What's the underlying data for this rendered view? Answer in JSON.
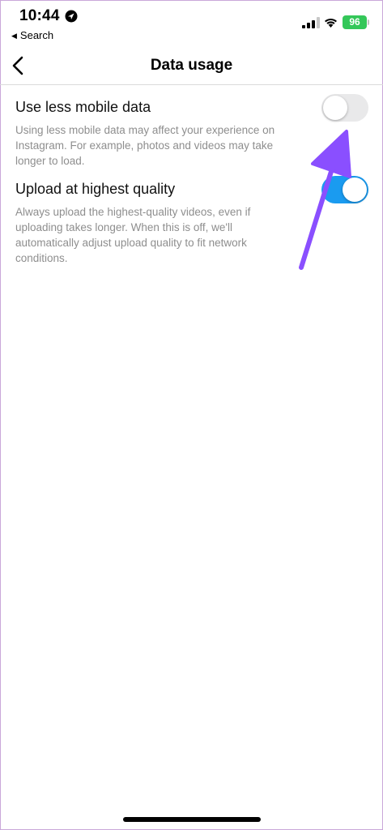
{
  "status_bar": {
    "time": "10:44",
    "back_app": "Search",
    "battery": "96",
    "icons": [
      "location-icon",
      "signal-icon",
      "wifi-icon",
      "battery-icon"
    ]
  },
  "nav": {
    "title": "Data usage",
    "back_icon": "chevron-left-icon"
  },
  "settings": [
    {
      "title": "Use less mobile data",
      "description": "Using less mobile data may affect your experience on Instagram. For example, photos and videos may take longer to load.",
      "enabled": false
    },
    {
      "title": "Upload at highest quality",
      "description": "Always upload the highest-quality videos, even if uploading takes longer. When this is off, we'll automatically adjust upload quality to fit network conditions.",
      "enabled": true
    }
  ],
  "colors": {
    "toggle_on": "#1a9bf0",
    "toggle_off": "#e9e9ea",
    "annotation_arrow": "#8a4fff",
    "battery": "#34c759",
    "secondary_text": "#8e8e8e"
  }
}
